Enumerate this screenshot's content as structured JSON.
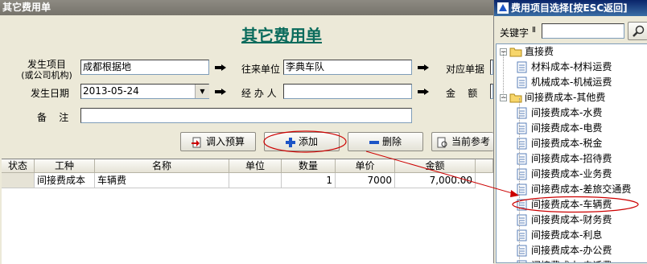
{
  "main": {
    "window_title": "其它费用单",
    "form_title": "其它费用单",
    "labels": {
      "project": "发生项目",
      "project_sub": "(或公司机构)",
      "partner": "往来单位",
      "related_doc": "对应单据",
      "date": "发生日期",
      "handler": "经 办 人",
      "amount": "金    额",
      "remark": "备    注"
    },
    "values": {
      "project": "成都根据地",
      "partner": "李典车队",
      "date": "2013-05-24",
      "handler": "",
      "remark": "",
      "related_doc": "",
      "amount": ""
    },
    "buttons": {
      "import_budget": "调入预算",
      "add": "添加",
      "delete": "删除",
      "current_ref": "当前参考"
    },
    "grid": {
      "columns": [
        "状态",
        "工种",
        "名称",
        "单位",
        "数量",
        "单价",
        "金额"
      ],
      "rows": [
        {
          "status": "",
          "type": "间接费成本",
          "name": "车辆费",
          "unit": "",
          "qty": "1",
          "price": "7000",
          "amount": "7,000.00"
        }
      ]
    }
  },
  "panel": {
    "title": "费用项目选择[按ESC返回]",
    "keyword_label": "关键字",
    "keyword_value": "",
    "tree": [
      {
        "label": "直接费",
        "level": 0,
        "kind": "folder",
        "expanded": true
      },
      {
        "label": "材料成本-材料运费",
        "level": 1,
        "kind": "item"
      },
      {
        "label": "机械成本-机械运费",
        "level": 1,
        "kind": "item"
      },
      {
        "label": "间接费成本-其他费",
        "level": 0,
        "kind": "folder",
        "expanded": true
      },
      {
        "label": "间接费成本-水费",
        "level": 1,
        "kind": "item"
      },
      {
        "label": "间接费成本-电费",
        "level": 1,
        "kind": "item"
      },
      {
        "label": "间接费成本-税金",
        "level": 1,
        "kind": "item"
      },
      {
        "label": "间接费成本-招待费",
        "level": 1,
        "kind": "item"
      },
      {
        "label": "间接费成本-业务费",
        "level": 1,
        "kind": "item"
      },
      {
        "label": "间接费成本-差旅交通费",
        "level": 1,
        "kind": "item"
      },
      {
        "label": "间接费成本-车辆费",
        "level": 1,
        "kind": "item",
        "highlighted": true
      },
      {
        "label": "间接费成本-财务费",
        "level": 1,
        "kind": "item"
      },
      {
        "label": "间接费成本-利息",
        "level": 1,
        "kind": "item"
      },
      {
        "label": "间接费成本-办公费",
        "level": 1,
        "kind": "item"
      },
      {
        "label": "间接费成本-电话费",
        "level": 1,
        "kind": "item"
      }
    ]
  },
  "colors": {
    "title_green": "#0a6b5c",
    "annotation_red": "#cc0000",
    "panel_title_blue": "#0a246a"
  }
}
